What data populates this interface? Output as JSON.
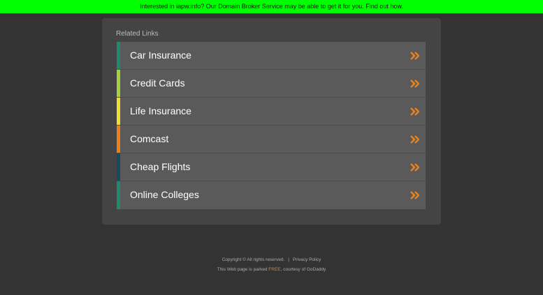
{
  "banner": {
    "text": "Interested in iapw.info? Our Domain Broker Service may be able to get it for you. Find out how.",
    "background": "#00ff00"
  },
  "related": {
    "title": "Related Links",
    "chevron_icon": "double-chevron-right-icon",
    "chevron_color": "#e8821e",
    "items": [
      {
        "label": "Car Insurance",
        "color": "#1e8a6e"
      },
      {
        "label": "Credit Cards",
        "color": "#a6d13a"
      },
      {
        "label": "Life Insurance",
        "color": "#f0dd2e"
      },
      {
        "label": "Comcast",
        "color": "#f07e1a"
      },
      {
        "label": "Cheap Flights",
        "color": "#164a5c"
      },
      {
        "label": "Online Colleges",
        "color": "#1e8a6e"
      }
    ]
  },
  "footer": {
    "copyright": "Copyright ©  All rights reserved.",
    "separator": "|",
    "privacy": "Privacy Policy",
    "parked_prefix": "This Web page is parked",
    "parked_free": "FREE",
    "parked_suffix": ", courtesy of GoDaddy"
  }
}
